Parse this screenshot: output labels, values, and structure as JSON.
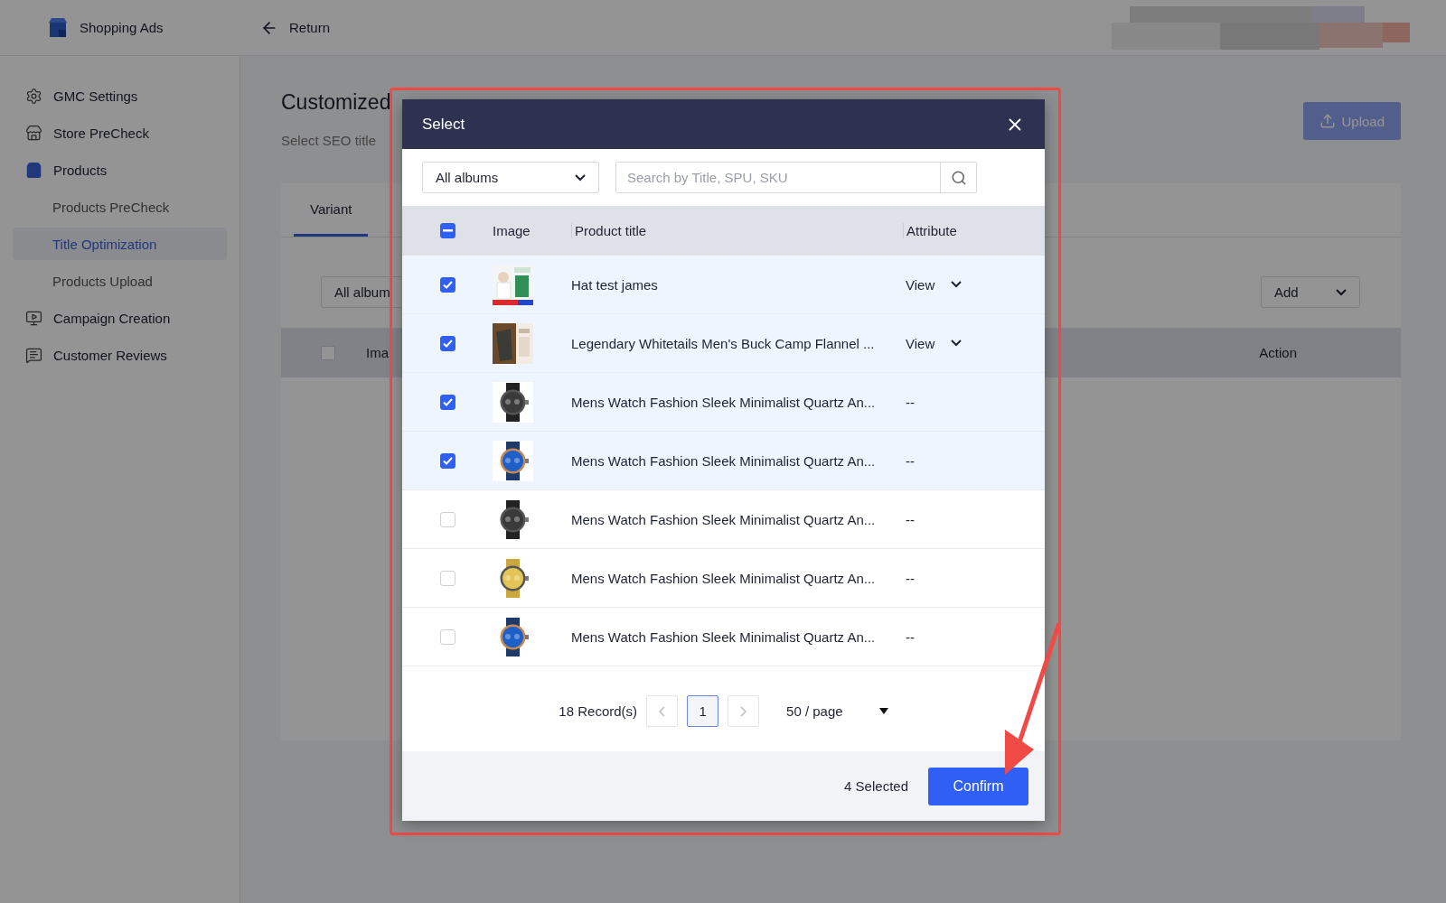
{
  "app": {
    "name": "Shopping Ads"
  },
  "topbar": {
    "back_label": "Return"
  },
  "sidebar": {
    "items": [
      {
        "label": "GMC Settings",
        "selected": false
      },
      {
        "label": "Store PreCheck",
        "selected": false
      },
      {
        "label": "Products",
        "selected": false,
        "children": [
          {
            "label": "Products PreCheck",
            "selected": false
          },
          {
            "label": "Title Optimization",
            "selected": true
          },
          {
            "label": "Products Upload",
            "selected": false
          }
        ]
      },
      {
        "label": "Campaign Creation",
        "selected": false
      },
      {
        "label": "Customer Reviews",
        "selected": false
      }
    ]
  },
  "page": {
    "title": "Customized",
    "subtitle": "Select SEO title",
    "upload_label": "Upload",
    "tabs": [
      {
        "label": "Variant",
        "selected": true
      }
    ],
    "album_filter": "All album",
    "add_label": "Add",
    "table": {
      "select_all_checked": false,
      "columns": [
        "Ima",
        "Action"
      ]
    }
  },
  "modal": {
    "title": "Select",
    "album_filter": "All albums",
    "search": {
      "placeholder": "Search by Title, SPU, SKU"
    },
    "table": {
      "indeterminate": true,
      "columns": [
        "Image",
        "Product title",
        "Attribute"
      ],
      "rows": [
        {
          "title": "Hat test james",
          "attribute": "View",
          "expandable": true,
          "selected": true
        },
        {
          "title": "Legendary Whitetails Men's Buck Camp Flannel ...",
          "attribute": "View",
          "expandable": true,
          "selected": true
        },
        {
          "title": "Mens Watch Fashion Sleek Minimalist Quartz An...",
          "attribute": "--",
          "expandable": false,
          "selected": true
        },
        {
          "title": "Mens Watch Fashion Sleek Minimalist Quartz An...",
          "attribute": "--",
          "expandable": false,
          "selected": true
        },
        {
          "title": "Mens Watch Fashion Sleek Minimalist Quartz An...",
          "attribute": "--",
          "expandable": false,
          "selected": false
        },
        {
          "title": "Mens Watch Fashion Sleek Minimalist Quartz An...",
          "attribute": "--",
          "expandable": false,
          "selected": false
        },
        {
          "title": "Mens Watch Fashion Sleek Minimalist Quartz An...",
          "attribute": "--",
          "expandable": false,
          "selected": false
        }
      ]
    },
    "pagination": {
      "total": "18 Record(s)",
      "pages": [
        {
          "label": "1",
          "selected": true
        }
      ],
      "page_size": "50 / page"
    },
    "footer": {
      "selected_count": "4 Selected",
      "confirm_label": "Confirm"
    }
  }
}
